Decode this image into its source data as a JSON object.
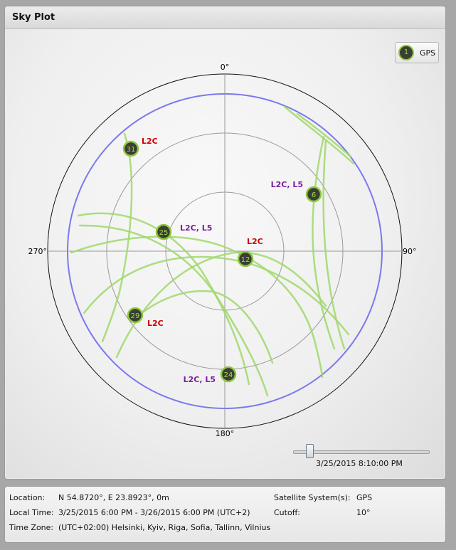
{
  "panel": {
    "title": "Sky Plot"
  },
  "legend": {
    "marker": "1",
    "label": "GPS"
  },
  "compass": {
    "north": "0°",
    "east": "90°",
    "south": "180°",
    "west": "270°"
  },
  "satellites": [
    {
      "prn": "31",
      "signals": "L2C",
      "signal_color": "#cc0000"
    },
    {
      "prn": "6",
      "signals": "L2C, L5",
      "signal_color": "#7a1fa0"
    },
    {
      "prn": "25",
      "signals": "L2C, L5",
      "signal_color": "#7a1fa0"
    },
    {
      "prn": "12",
      "signals": "L2C",
      "signal_color": "#cc0000"
    },
    {
      "prn": "29",
      "signals": "L2C",
      "signal_color": "#cc0000"
    },
    {
      "prn": "24",
      "signals": "L2C, L5",
      "signal_color": "#7a1fa0"
    }
  ],
  "colors": {
    "track": "#9fd86a",
    "marker_fill": "#3a3e33",
    "marker_ring": "#8ec63f",
    "marker_text": "#a3d94e",
    "cutoff_circle": "#7a78ee",
    "grid": "#9a9a9a"
  },
  "time_slider": {
    "position_fraction": 0.1,
    "label": "3/25/2015 8:10:00 PM"
  },
  "info": {
    "location_label": "Location:",
    "location_value": "N 54.8720°, E 23.8923°, 0m",
    "local_time_label": "Local Time:",
    "local_time_value": "3/25/2015 6:00 PM - 3/26/2015 6:00 PM (UTC+2)",
    "time_zone_label": "Time Zone:",
    "time_zone_value": "(UTC+02:00) Helsinki, Kyiv, Riga, Sofia, Tallinn, Vilnius",
    "systems_label": "Satellite System(s):",
    "systems_value": "GPS",
    "cutoff_label": "Cutoff:",
    "cutoff_value": "10°"
  }
}
